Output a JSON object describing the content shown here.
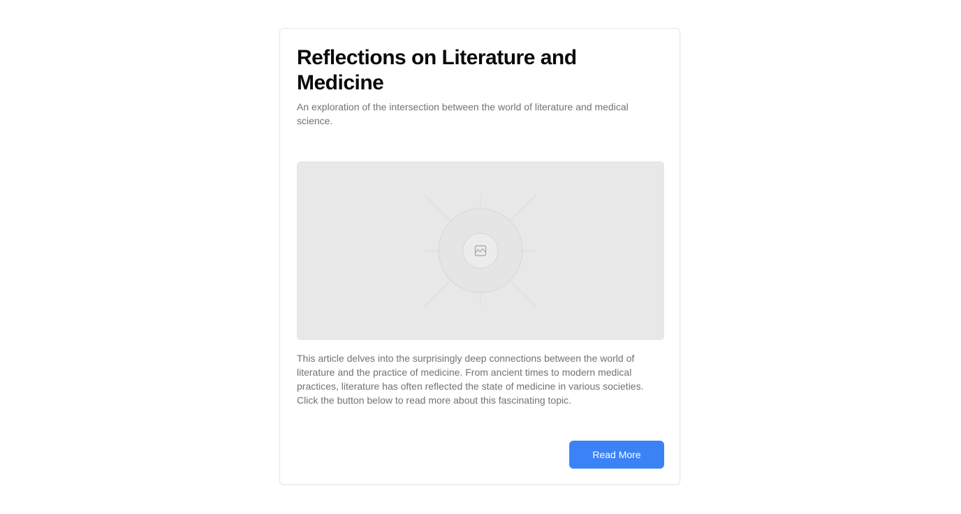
{
  "article": {
    "title": "Reflections on Literature and Medicine",
    "subtitle": "An exploration of the intersection between the world of literature and medical science.",
    "image_icon": "image-icon",
    "body": "This article delves into the surprisingly deep connections between the world of literature and the practice of medicine. From ancient times to modern medical practices, literature has often reflected the state of medicine in various societies. Click the button below to read more about this fascinating topic.",
    "button_label": "Read More"
  },
  "colors": {
    "accent": "#3b82f6",
    "placeholder_bg": "#e8e8e8",
    "muted_text": "#71717a",
    "title_text": "#0a0a0a"
  }
}
